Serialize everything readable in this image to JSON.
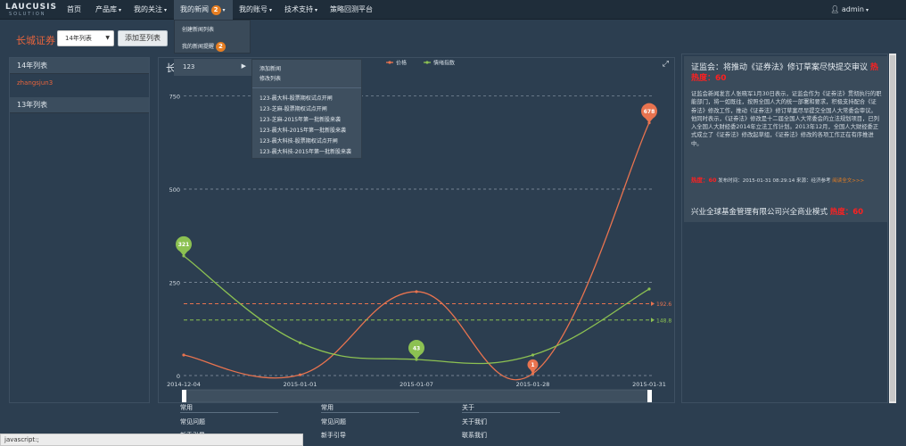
{
  "nav": {
    "logo_main": "LAUCUSIS",
    "logo_sub": "SOLUTION",
    "items": [
      "首页",
      "产品库",
      "我的关注",
      "我的新闻",
      "我的账号",
      "技术支持",
      "策略回测平台"
    ],
    "news_badge": "2",
    "user": "admin"
  },
  "news_dropdown": {
    "create": "创建新闻列表",
    "my_reminder": "我的新闻提醒",
    "my_reminder_badge": "2"
  },
  "toolbar": {
    "title": "长城证券",
    "select_value": "14年列表",
    "add_button": "添加至列表"
  },
  "left_panel": {
    "group1_title": "14年列表",
    "group1_item": "zhangsjun3",
    "group2_title": "13年列表"
  },
  "chart_panel": {
    "title_visible": "长"
  },
  "submenu": {
    "label": "123",
    "actions": [
      "添加新闻",
      "修改列表"
    ],
    "news": [
      "123-晨大科-股票期权试点开闸",
      "123-芝麻-股票期权试点开闸",
      "123-芝麻-2015年第一批新股来袭",
      "123-晨大科-2015年第一批新股来袭",
      "123-晨大科技-股票期权试点开闸",
      "123-晨大科技-2015年第一批新股来袭"
    ]
  },
  "right_panel": {
    "article1_title": "证监会：将推动《证券法》修订草案尽快提交审议",
    "article1_hot": "热",
    "article1_score": "热度：60",
    "article1_body": "证监会新闻发言人张晓军1月30日表示，证监会作为《证券法》贯彻执行的职能部门，将一如既往，按照全国人大的统一部署和要求，积极支持配合《证券法》修改工作，推动《证券法》修订草案尽早提交全国人大常委会审议。        他同时表示，《证券法》修改是十二届全国人大常委会的立法规划项目，已列入全国人大财经委2014年立法工作计划。2013年12月，全国人大财经委正式成立了《证券法》修改起草组，《证券法》修改的各项工作正在有序推进中。",
    "article1_published": "发布时间：2015-01-31 08:29:14",
    "article1_source": "来源：经济参考",
    "article1_more": "阅读全文>>>",
    "article2_title": "兴业全球基金管理有限公司兴全商业模式",
    "article2_score": "热度：60"
  },
  "footer": {
    "col1_title": "常用",
    "col1_links": [
      "常见问题",
      "新手引导"
    ],
    "col2_title": "常用",
    "col2_links": [
      "常见问题",
      "新手引导"
    ],
    "col3_title": "关于",
    "col3_links": [
      "关于我们",
      "联系我们"
    ]
  },
  "statusbar": "javascript:;",
  "chart_data": {
    "type": "line",
    "x": [
      "2014-12-04",
      "2015-01-01",
      "2015-01-07",
      "2015-01-28",
      "2015-01-31"
    ],
    "yticks": [
      0,
      250,
      500,
      750
    ],
    "ylim": [
      0,
      780
    ],
    "series": [
      {
        "name": "价格",
        "color": "#e8734f",
        "values": [
          55,
          2,
          225,
          5,
          678
        ],
        "markers": [
          {
            "index": 4,
            "label": "678"
          },
          {
            "index": 3,
            "label": "1"
          }
        ],
        "average": 192.6
      },
      {
        "name": "情绪指数",
        "color": "#8cc152",
        "values": [
          321,
          88,
          43,
          55,
          232
        ],
        "markers": [
          {
            "index": 0,
            "label": "321"
          },
          {
            "index": 2,
            "label": "43"
          }
        ],
        "average": 148.8
      }
    ]
  }
}
